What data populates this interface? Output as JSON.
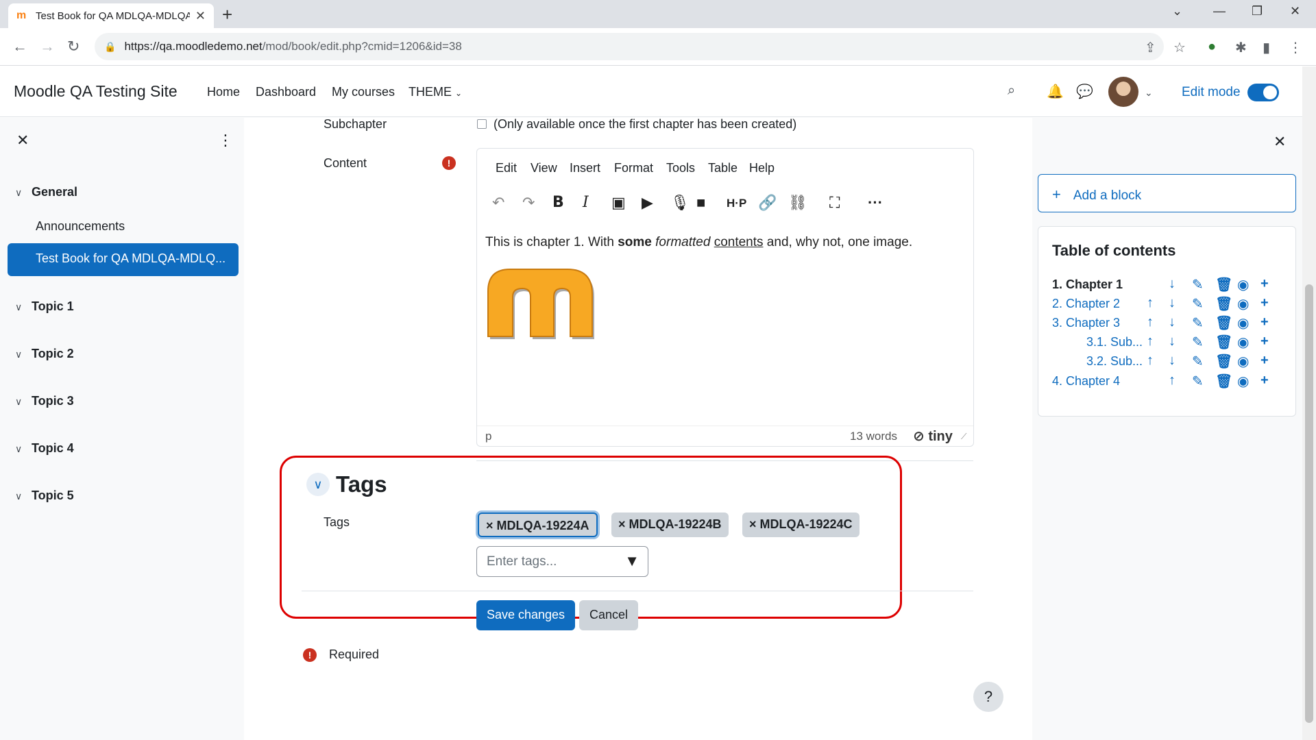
{
  "browser": {
    "tab_title": "Test Book for QA MDLQA-MDLQA",
    "tab_favicon": "m",
    "url_host": "https://qa.moodledemo.net",
    "url_path": "/mod/book/edit.php?cmid=1206&id=38"
  },
  "topnav": {
    "site_name": "Moodle QA Testing Site",
    "links": [
      "Home",
      "Dashboard",
      "My courses",
      "THEME"
    ],
    "edit_mode_label": "Edit mode",
    "edit_mode_on": true
  },
  "left_drawer": {
    "sections": [
      {
        "label": "General",
        "activities": [
          "Announcements",
          "Test Book for QA MDLQA-MDLQ..."
        ]
      },
      {
        "label": "Topic 1"
      },
      {
        "label": "Topic 2"
      },
      {
        "label": "Topic 3"
      },
      {
        "label": "Topic 4"
      },
      {
        "label": "Topic 5"
      }
    ]
  },
  "form": {
    "subchapter_label": "Subchapter",
    "subchapter_note": "(Only available once the first chapter has been created)",
    "content_label": "Content",
    "editor_menu": [
      "Edit",
      "View",
      "Insert",
      "Format",
      "Tools",
      "Table",
      "Help"
    ],
    "editor_text_1": "This is chapter 1. With ",
    "editor_text_bold": "some",
    "editor_text_italic": "formatted",
    "editor_text_underline": "contents",
    "editor_text_2": " and, why not, one image.",
    "status_path": "p",
    "word_count": "13 words",
    "brand": "tiny",
    "tags_heading": "Tags",
    "tags_label": "Tags",
    "tags": [
      "MDLQA-19224A",
      "MDLQA-19224B",
      "MDLQA-19224C"
    ],
    "tags_placeholder": "Enter tags...",
    "save_label": "Save changes",
    "cancel_label": "Cancel",
    "required_label": "Required"
  },
  "right_drawer": {
    "add_block_label": "Add a block",
    "toc_title": "Table of contents",
    "toc": [
      {
        "label": "1. Chapter 1",
        "current": true
      },
      {
        "label": "2. Chapter 2"
      },
      {
        "label": "3. Chapter 3"
      },
      {
        "label": "3.1. Sub..."
      },
      {
        "label": "3.2. Sub..."
      },
      {
        "label": "4. Chapter 4"
      }
    ]
  },
  "colors": {
    "primary": "#0f6cbf",
    "danger": "#ca3120",
    "highlight_box": "#dd0000"
  }
}
